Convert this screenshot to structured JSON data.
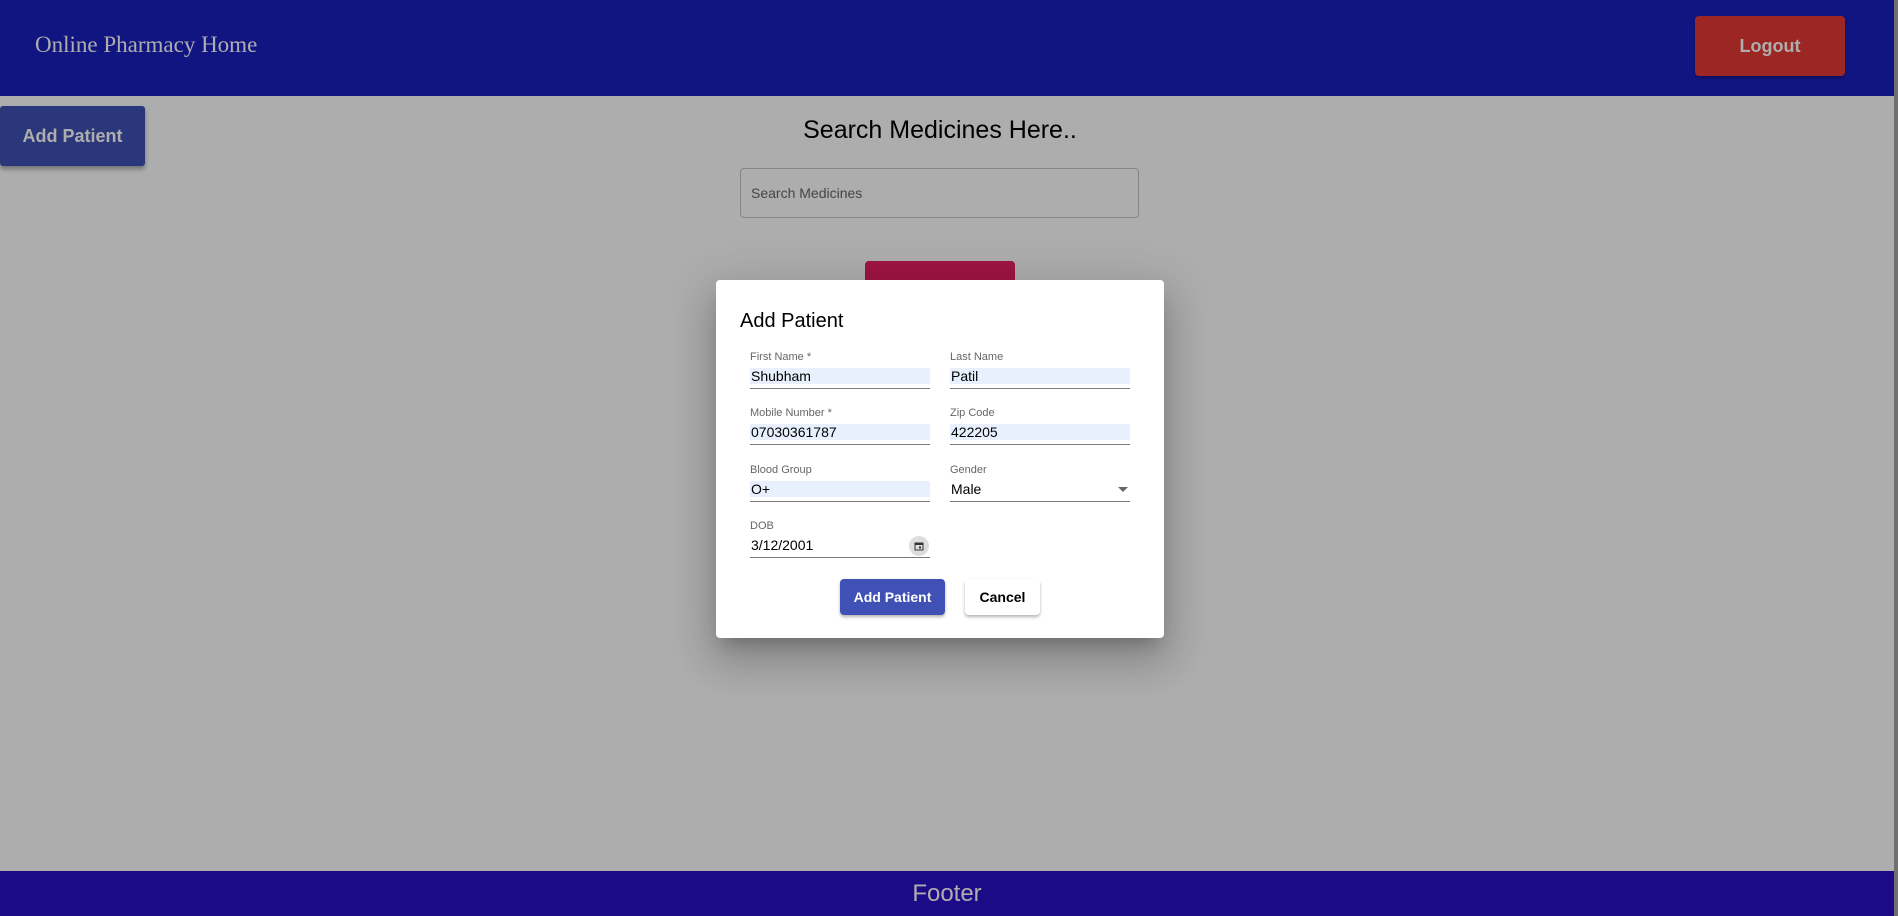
{
  "header": {
    "brand": "Online Pharmacy Home",
    "logout_label": "Logout"
  },
  "main": {
    "add_patient_label": "Add Patient",
    "search_title": "Search Medicines Here..",
    "search_placeholder": "Search Medicines"
  },
  "footer": {
    "text": "Footer"
  },
  "dialog": {
    "title": "Add Patient",
    "fields": {
      "first_name": {
        "label": "First Name *",
        "value": "Shubham"
      },
      "last_name": {
        "label": "Last Name",
        "value": "Patil"
      },
      "mobile": {
        "label": "Mobile Number *",
        "value": "07030361787"
      },
      "zip": {
        "label": "Zip Code",
        "value": "422205"
      },
      "blood_group": {
        "label": "Blood Group",
        "value": "O+"
      },
      "gender": {
        "label": "Gender",
        "value": "Male"
      },
      "dob": {
        "label": "DOB",
        "value": "3/12/2001"
      }
    },
    "submit_label": "Add Patient",
    "cancel_label": "Cancel"
  },
  "colors": {
    "header": "#1a1fbf",
    "footer": "#2a10c7",
    "logout": "#e53935",
    "primary": "#3f51b5",
    "accent": "#e91e63"
  },
  "icons": {
    "gender_select": "chevron-down-icon",
    "dob_picker": "calendar-icon"
  }
}
